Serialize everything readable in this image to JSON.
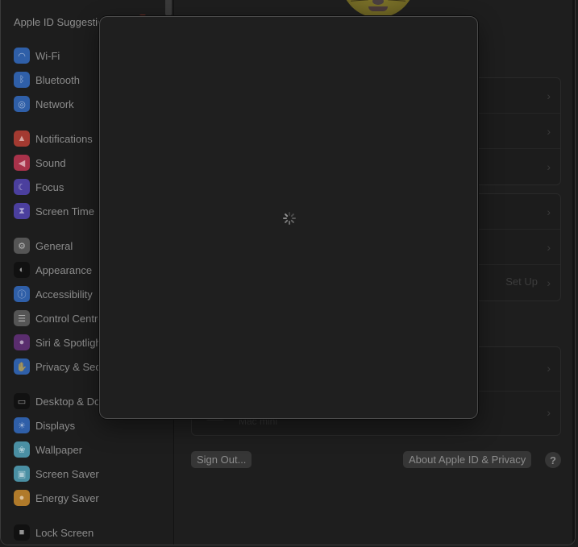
{
  "sidebar": {
    "apple_id_label": "Apple ID Suggestions",
    "groups": [
      [
        {
          "label": "Wi-Fi",
          "icon": "wifi-icon",
          "glyph": "◠",
          "color": "#2f5fa8"
        },
        {
          "label": "Bluetooth",
          "icon": "bluetooth-icon",
          "glyph": "ᛒ",
          "color": "#2f5fa8"
        },
        {
          "label": "Network",
          "icon": "globe-icon",
          "glyph": "◎",
          "color": "#2f5fa8"
        }
      ],
      [
        {
          "label": "Notifications",
          "icon": "bell-icon",
          "glyph": "▲",
          "color": "#a33a31"
        },
        {
          "label": "Sound",
          "icon": "speaker-icon",
          "glyph": "◀",
          "color": "#a8324a"
        },
        {
          "label": "Focus",
          "icon": "moon-icon",
          "glyph": "☾",
          "color": "#4b3f9e"
        },
        {
          "label": "Screen Time",
          "icon": "hourglass-icon",
          "glyph": "⧗",
          "color": "#4b3f9e"
        }
      ],
      [
        {
          "label": "General",
          "icon": "gear-icon",
          "glyph": "⚙",
          "color": "#555555"
        },
        {
          "label": "Appearance",
          "icon": "appearance-icon",
          "glyph": "◐",
          "color": "#111111"
        },
        {
          "label": "Accessibility",
          "icon": "accessibility-icon",
          "glyph": "ⓘ",
          "color": "#2f5fa8"
        },
        {
          "label": "Control Centre",
          "icon": "toggles-icon",
          "glyph": "☰",
          "color": "#555555"
        },
        {
          "label": "Siri & Spotlight",
          "icon": "siri-icon",
          "glyph": "●",
          "color": "#5a2d6e"
        },
        {
          "label": "Privacy & Security",
          "icon": "hand-icon",
          "glyph": "✋",
          "color": "#2f5fa8"
        }
      ],
      [
        {
          "label": "Desktop & Dock",
          "icon": "dock-icon",
          "glyph": "▭",
          "color": "#111111"
        },
        {
          "label": "Displays",
          "icon": "sun-icon",
          "glyph": "☀",
          "color": "#2f5fa8"
        },
        {
          "label": "Wallpaper",
          "icon": "flower-icon",
          "glyph": "❀",
          "color": "#4a8fa3"
        },
        {
          "label": "Screen Saver",
          "icon": "screensaver-icon",
          "glyph": "▣",
          "color": "#4a8fa3"
        },
        {
          "label": "Energy Saver",
          "icon": "lightbulb-icon",
          "glyph": "●",
          "color": "#b07a2a"
        }
      ],
      [
        {
          "label": "Lock Screen",
          "icon": "lock-icon",
          "glyph": "■",
          "color": "#111111"
        }
      ]
    ]
  },
  "main": {
    "group1_rows": 3,
    "group2": {
      "setup_label": "Set Up"
    },
    "device_name": "Mac mini",
    "sign_out_label": "Sign Out...",
    "about_label": "About Apple ID & Privacy",
    "help_label": "?"
  },
  "sheet": {
    "state": "loading"
  }
}
